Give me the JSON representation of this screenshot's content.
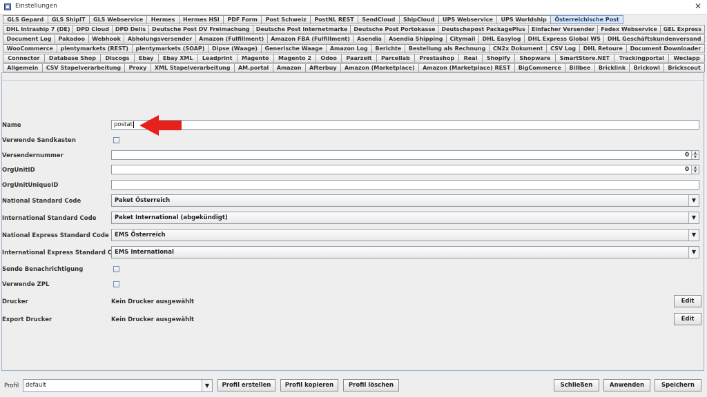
{
  "window": {
    "title": "Einstellungen",
    "close_glyph": "✕"
  },
  "tabs": {
    "rows": [
      [
        "GLS Gepard",
        "GLS ShipIT",
        "GLS Webservice",
        "Hermes",
        "Hermes HSI",
        "PDF Form",
        "Post Schweiz",
        "PostNL REST",
        "SendCloud",
        "ShipCloud",
        "UPS Webservice",
        "UPS Worldship",
        "Österreichische Post"
      ],
      [
        "DHL Intraship 7 (DE)",
        "DPD Cloud",
        "DPD Delis",
        "Deutsche Post DV Freimachung",
        "Deutsche Post Internetmarke",
        "Deutsche Post Portokasse",
        "Deutschepost PackagePlus",
        "Einfacher Versender",
        "Fedex Webservice",
        "GEL Express"
      ],
      [
        "Document Log",
        "Pakadoo",
        "Webhook",
        "Abholungsversender",
        "Amazon (Fulfillment)",
        "Amazon FBA (Fulfillment)",
        "Asendia",
        "Asendia Shipping",
        "Citymail",
        "DHL Easylog",
        "DHL Express Global WS",
        "DHL Geschäftskundenversand"
      ],
      [
        "WooCommerce",
        "plentymarkets (REST)",
        "plentymarkets (SOAP)",
        "Dipse (Waage)",
        "Generische Waage",
        "Amazon Log",
        "Berichte",
        "Bestellung als Rechnung",
        "CN2x Dokument",
        "CSV Log",
        "DHL Retoure",
        "Document Downloader"
      ],
      [
        "Connector",
        "Database Shop",
        "Discogs",
        "Ebay",
        "Ebay XML",
        "Leadprint",
        "Magento",
        "Magento 2",
        "Odoo",
        "Paarzeit",
        "Parcellab",
        "Prestashop",
        "Real",
        "Shopify",
        "Shopware",
        "SmartStore.NET",
        "Trackingportal",
        "Weclapp"
      ],
      [
        "Allgemein",
        "CSV Stapelverarbeitung",
        "Proxy",
        "XML Stapelverarbeitung",
        "AM.portal",
        "Amazon",
        "Afterbuy",
        "Amazon (Marketplace)",
        "Amazon (Marketplace) REST",
        "BigCommerce",
        "Billbee",
        "Bricklink",
        "Brickowl",
        "Brickscout"
      ]
    ],
    "active": "Österreichische Post"
  },
  "form": {
    "name_label": "Name",
    "name_value": "postat",
    "sandbox_label": "Verwende Sandkasten",
    "sender_number_label": "Versendernummer",
    "sender_number_value": "0",
    "org_unit_id_label": "OrgUnitID",
    "org_unit_id_value": "0",
    "org_unit_unique_id_label": "OrgUnitUniqueID",
    "org_unit_unique_id_value": "",
    "national_standard_label": "National Standard Code",
    "national_standard_value": "Paket Österreich",
    "international_standard_label": "International Standard Code",
    "international_standard_value": "Paket International (abgekündigt)",
    "national_express_label": "National Express Standard Code",
    "national_express_value": "EMS Österreich",
    "international_express_label": "International Express Standard Code",
    "international_express_value": "EMS International",
    "send_notification_label": "Sende Benachrichtigung",
    "use_zpl_label": "Verwende ZPL",
    "printer_label": "Drucker",
    "printer_value": "Kein Drucker ausgewählt",
    "printer_edit_label": "Edit",
    "export_printer_label": "Export Drucker",
    "export_printer_value": "Kein Drucker ausgewählt",
    "export_printer_edit_label": "Edit"
  },
  "footer": {
    "profile_label": "Profil",
    "profile_value": "default",
    "create_profile_label": "Profil erstellen",
    "copy_profile_label": "Profil kopieren",
    "delete_profile_label": "Profil löschen",
    "close_label": "Schließen",
    "apply_label": "Anwenden",
    "save_label": "Speichern"
  },
  "icons": {
    "app": "app-icon",
    "close": "close-icon",
    "dropdown": "chevron-down-icon",
    "annotation": "red-arrow-icon"
  },
  "colors": {
    "active_tab": "#dde8f5",
    "annotation_arrow": "#e8201c"
  }
}
